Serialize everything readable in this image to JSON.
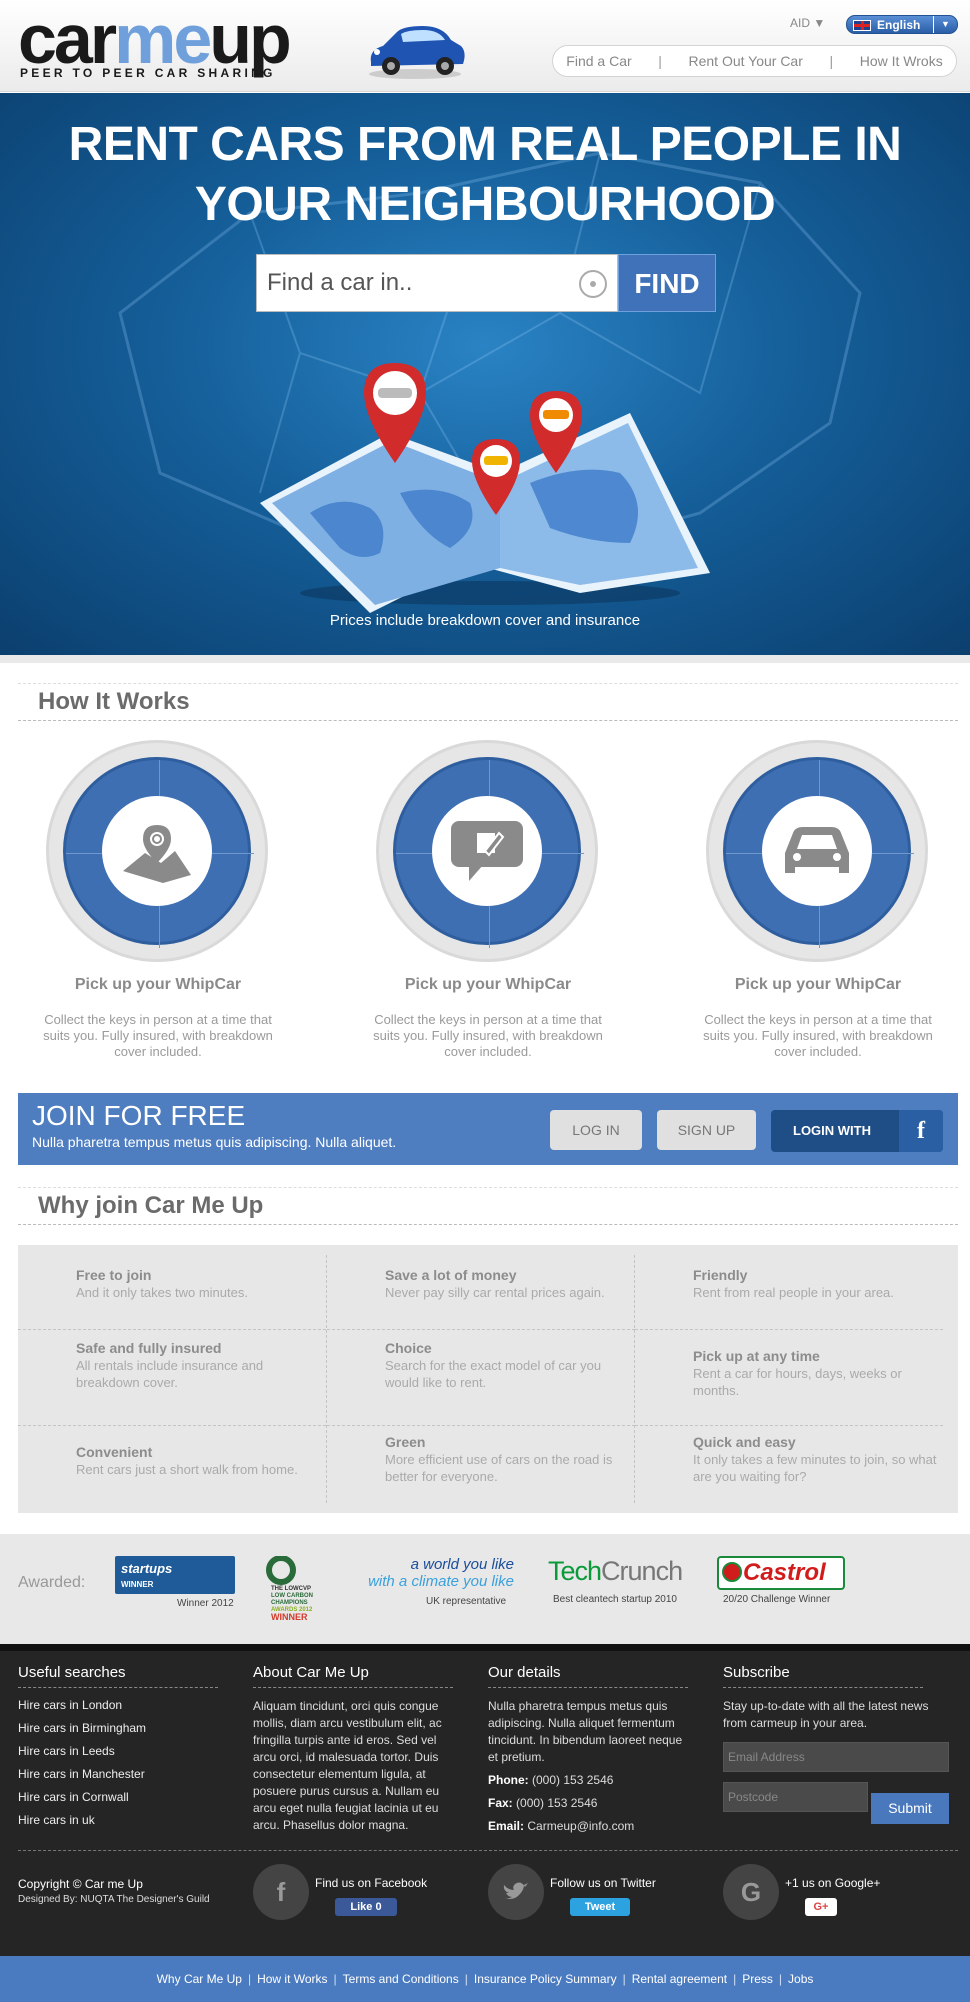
{
  "header": {
    "logo_text_a": "car",
    "logo_text_b": "me",
    "logo_text_c": "up",
    "tagline": "PEER TO PEER CAR SHARING",
    "currency": "AID",
    "language": "English",
    "nav": [
      "Find a Car",
      "Rent Out Your Car",
      "How It Wroks"
    ]
  },
  "hero": {
    "title_line1": "RENT CARS FROM REAL PEOPLE IN",
    "title_line2": "YOUR NEIGHBOURHOOD",
    "search_placeholder": "Find a car in..",
    "find_label": "FIND",
    "note": "Prices include breakdown cover and insurance"
  },
  "how_it_works": {
    "title": "How It Works",
    "steps": [
      {
        "icon": "map-pin-icon",
        "title": "Pick up your WhipCar",
        "text": "Collect the keys in person at a time that suits you. Fully insured, with breakdown cover included."
      },
      {
        "icon": "chat-edit-icon",
        "title": "Pick up your WhipCar",
        "text": "Collect the keys in person at a time that suits you. Fully insured, with breakdown cover included."
      },
      {
        "icon": "car-icon",
        "title": "Pick up your WhipCar",
        "text": "Collect the keys in person at a time that suits you. Fully insured, with breakdown cover included."
      }
    ]
  },
  "join": {
    "title": "JOIN FOR FREE",
    "subtitle": "Nulla pharetra tempus metus quis adipiscing. Nulla aliquet.",
    "login": "LOG IN",
    "signup": "SIGN UP",
    "facebook": "LOGIN WITH",
    "fb_letter": "f"
  },
  "why": {
    "title": "Why join Car Me Up",
    "cols": [
      [
        {
          "title": "Free to join",
          "text": "And it only takes two minutes."
        },
        {
          "title": "Safe and fully insured",
          "text": "All rentals include insurance and breakdown cover."
        },
        {
          "title": "Convenient",
          "text": "Rent cars just a short walk from home."
        }
      ],
      [
        {
          "title": "Save a lot of money",
          "text": "Never pay silly car rental prices again."
        },
        {
          "title": "Choice",
          "text": "Search for the exact model of car you would like to rent."
        },
        {
          "title": "Green",
          "text": "More efficient use of cars on the road is better for everyone."
        }
      ],
      [
        {
          "title": "Friendly",
          "text": "Rent from real people in your area."
        },
        {
          "title": "Pick up at any time",
          "text": "Rent a car for hours, days, weeks or months."
        },
        {
          "title": "Quick and easy",
          "text": "It only takes a few minutes to join, so what are you waiting for?"
        }
      ]
    ]
  },
  "awards": {
    "label": "Awarded:",
    "startups_name": "startups",
    "startups_sub": "WINNER",
    "startups_caption": "Winner 2012",
    "lowcarbon_lines": [
      "THE LOWCVP",
      "LOW CARBON",
      "CHAMPIONS",
      "AWARDS 2012",
      "WINNER"
    ],
    "climate_line1": "a world you like",
    "climate_line2": "with a climate you like",
    "climate_caption": "UK representative",
    "techcrunch_a": "Tech",
    "techcrunch_b": "Crunch",
    "techcrunch_caption": "Best cleantech startup 2010",
    "castrol_name": "Castrol",
    "castrol_caption": "20/20 Challenge Winner"
  },
  "footer": {
    "useful": {
      "title": "Useful searches",
      "links": [
        "Hire cars in London",
        "Hire cars in Birmingham",
        "Hire cars in Leeds",
        "Hire cars in Manchester",
        "Hire cars in Cornwall",
        "Hire cars in uk"
      ]
    },
    "about": {
      "title": "About Car Me Up",
      "text": "Aliquam tincidunt, orci quis congue mollis, diam arcu vestibulum elit, ac fringilla turpis ante id eros. Sed vel arcu orci, id malesuada tortor. Duis consectetur elementum ligula, at posuere purus cursus a. Nullam eu arcu eget nulla feugiat lacinia ut eu arcu. Phasellus dolor magna."
    },
    "details": {
      "title": "Our details",
      "text": "Nulla pharetra tempus metus quis adipiscing. Nulla aliquet fermentum tincidunt. In bibendum laoreet neque et pretium.",
      "phone_label": "Phone:",
      "phone": "(000) 153 2546",
      "fax_label": "Fax:",
      "fax": "(000) 153 2546",
      "email_label": "Email:",
      "email": "Carmeup@info.com"
    },
    "subscribe": {
      "title": "Subscribe",
      "text": "Stay up-to-date with all the latest news from carmeup in your area.",
      "email_placeholder": "Email Address",
      "postcode_placeholder": "Postcode",
      "submit": "Submit"
    },
    "copyright": "Copyright © Car me Up",
    "designed": "Designed By: NUQTA The Designer's Guild",
    "facebook": {
      "label": "Find us on Facebook",
      "button": "Like 0",
      "glyph": "f"
    },
    "twitter": {
      "label": "Follow us on Twitter",
      "button": "Tweet"
    },
    "google": {
      "label": "+1 us on Google+",
      "button": "G+",
      "glyph": "G"
    }
  },
  "bottom_links": [
    "Why Car Me Up",
    "How it Works",
    "Terms and Conditions",
    "Insurance Policy Summary",
    "Rental agreement",
    "Press",
    "Jobs"
  ],
  "colors": {
    "brand_blue": "#4e7dc0",
    "dark": "#252525",
    "hero": "#155f9a"
  }
}
